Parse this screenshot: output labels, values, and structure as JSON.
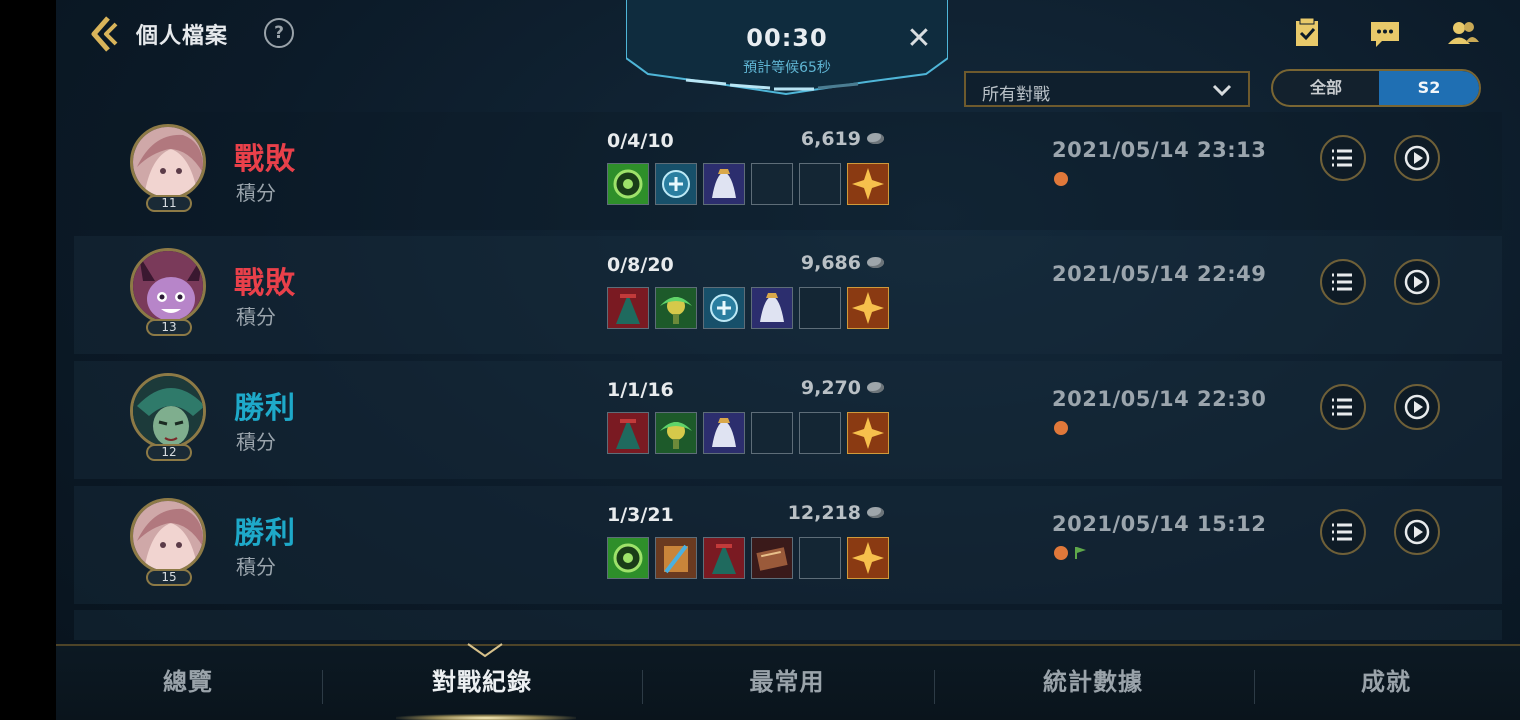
{
  "header": {
    "title": "個人檔案",
    "help_label": "?"
  },
  "queue": {
    "timer": "00:30",
    "estimate": "預計等候65秒",
    "close_label": "✕"
  },
  "filters": {
    "mode_selected": "所有對戰",
    "season_options": [
      "全部",
      "S2"
    ],
    "season_selected": "S2"
  },
  "matches": [
    {
      "level": "11",
      "result": "戰敗",
      "mode": "積分",
      "kda": "0/4/10",
      "gold": "6,619",
      "date": "2021/05/14 23:13"
    },
    {
      "level": "13",
      "result": "戰敗",
      "mode": "積分",
      "kda": "0/8/20",
      "gold": "9,686",
      "date": "2021/05/14 22:49"
    },
    {
      "level": "12",
      "result": "勝利",
      "mode": "積分",
      "kda": "1/1/16",
      "gold": "9,270",
      "date": "2021/05/14 22:30"
    },
    {
      "level": "15",
      "result": "勝利",
      "mode": "積分",
      "kda": "1/3/21",
      "gold": "12,218",
      "date": "2021/05/14 15:12"
    }
  ],
  "tabs": [
    "總覽",
    "對戰紀錄",
    "最常用",
    "統計數據",
    "成就"
  ],
  "active_tab": "對戰紀錄",
  "colors": {
    "defeat": "#e9404a",
    "victory": "#1ea9c9",
    "accent_gold": "#8d7a46",
    "segment_active": "#1f6fb3"
  }
}
